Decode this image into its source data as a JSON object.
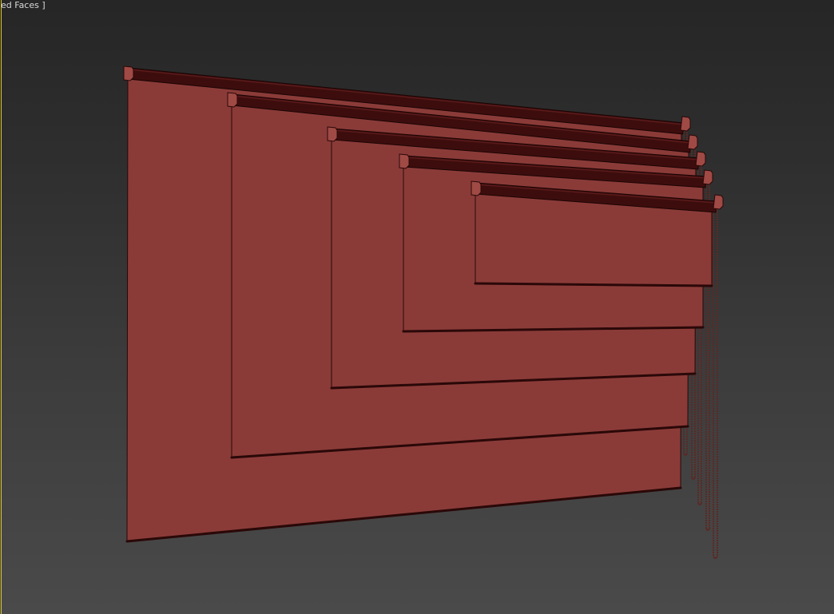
{
  "viewport": {
    "label": "ed Faces ]"
  },
  "colors": {
    "background_top": "#262626",
    "background_bottom": "#4a4a4a",
    "viewport_border": "#d8c832",
    "blind_fabric": "#8a3b38",
    "blind_fabric_shade": "#7d3532",
    "blind_outline": "#2a0808",
    "roller_tube": "#3d0d0d",
    "roller_highlight": "#5a1a1a",
    "bracket": "#a04a45",
    "cord": "#5a2a26"
  },
  "scene": {
    "object_type": "roller-blinds",
    "count": 5
  }
}
